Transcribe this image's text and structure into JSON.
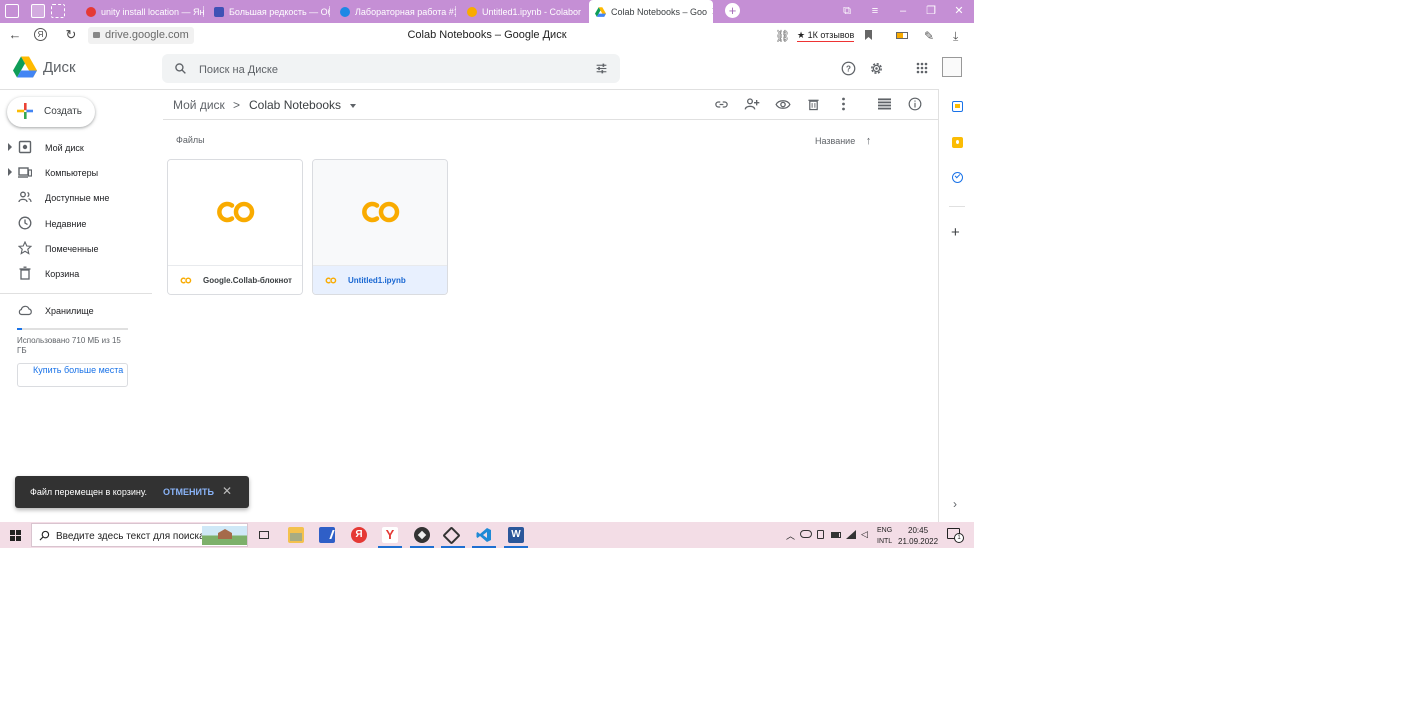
{
  "browser": {
    "tabs": [
      {
        "title": "unity install location — Ян",
        "favicon_color": "#e53935"
      },
      {
        "title": "Большая редкость — Об",
        "favicon_color": "#3f51b5"
      },
      {
        "title": "Лабораторная работа #1",
        "favicon_color": "#1e88e5"
      },
      {
        "title": "Untitled1.ipynb - Colabor",
        "favicon_color": "#f9ab00"
      },
      {
        "title": "Colab Notebooks – Goo",
        "favicon_color": "#1a73e8",
        "active": true
      }
    ],
    "new_tab_label": "+",
    "url": "drive.google.com",
    "page_title": "Colab Notebooks – Google Диск",
    "reviews": "★ 1К отзывов"
  },
  "drive": {
    "brand": "Диск",
    "search_placeholder": "Поиск на Диске",
    "create_label": "Создать",
    "nav": [
      {
        "label": "Мой диск",
        "icon": "my-drive-icon",
        "expandable": true
      },
      {
        "label": "Компьютеры",
        "icon": "computers-icon",
        "expandable": true
      },
      {
        "label": "Доступные мне",
        "icon": "shared-icon",
        "expandable": false
      },
      {
        "label": "Недавние",
        "icon": "clock-icon",
        "expandable": false
      },
      {
        "label": "Помеченные",
        "icon": "star-icon",
        "expandable": false
      },
      {
        "label": "Корзина",
        "icon": "trash-icon",
        "expandable": false
      }
    ],
    "storage": {
      "label": "Хранилище",
      "used_text": "Использовано 710 МБ из 15 ГБ",
      "used_fraction": 0.047,
      "buy_label": "Купить больше места"
    },
    "breadcrumb": {
      "root": "Мой диск",
      "separator": ">",
      "current": "Colab Notebooks"
    },
    "files_label": "Файлы",
    "sort_label": "Название",
    "files": [
      {
        "name": "Google.Collab-блокнот",
        "selected": false
      },
      {
        "name": "Untitled1.ipynb",
        "selected": true
      }
    ],
    "snackbar": {
      "message": "Файл перемещен в корзину.",
      "action": "ОТМЕНИТЬ",
      "close": "✕"
    }
  },
  "taskbar": {
    "search_text": "Введите здесь текст для поиска",
    "lang_top": "ENG",
    "lang_bottom": "INTL",
    "time": "20:45",
    "date": "21.09.2022",
    "notification_count": "1"
  }
}
